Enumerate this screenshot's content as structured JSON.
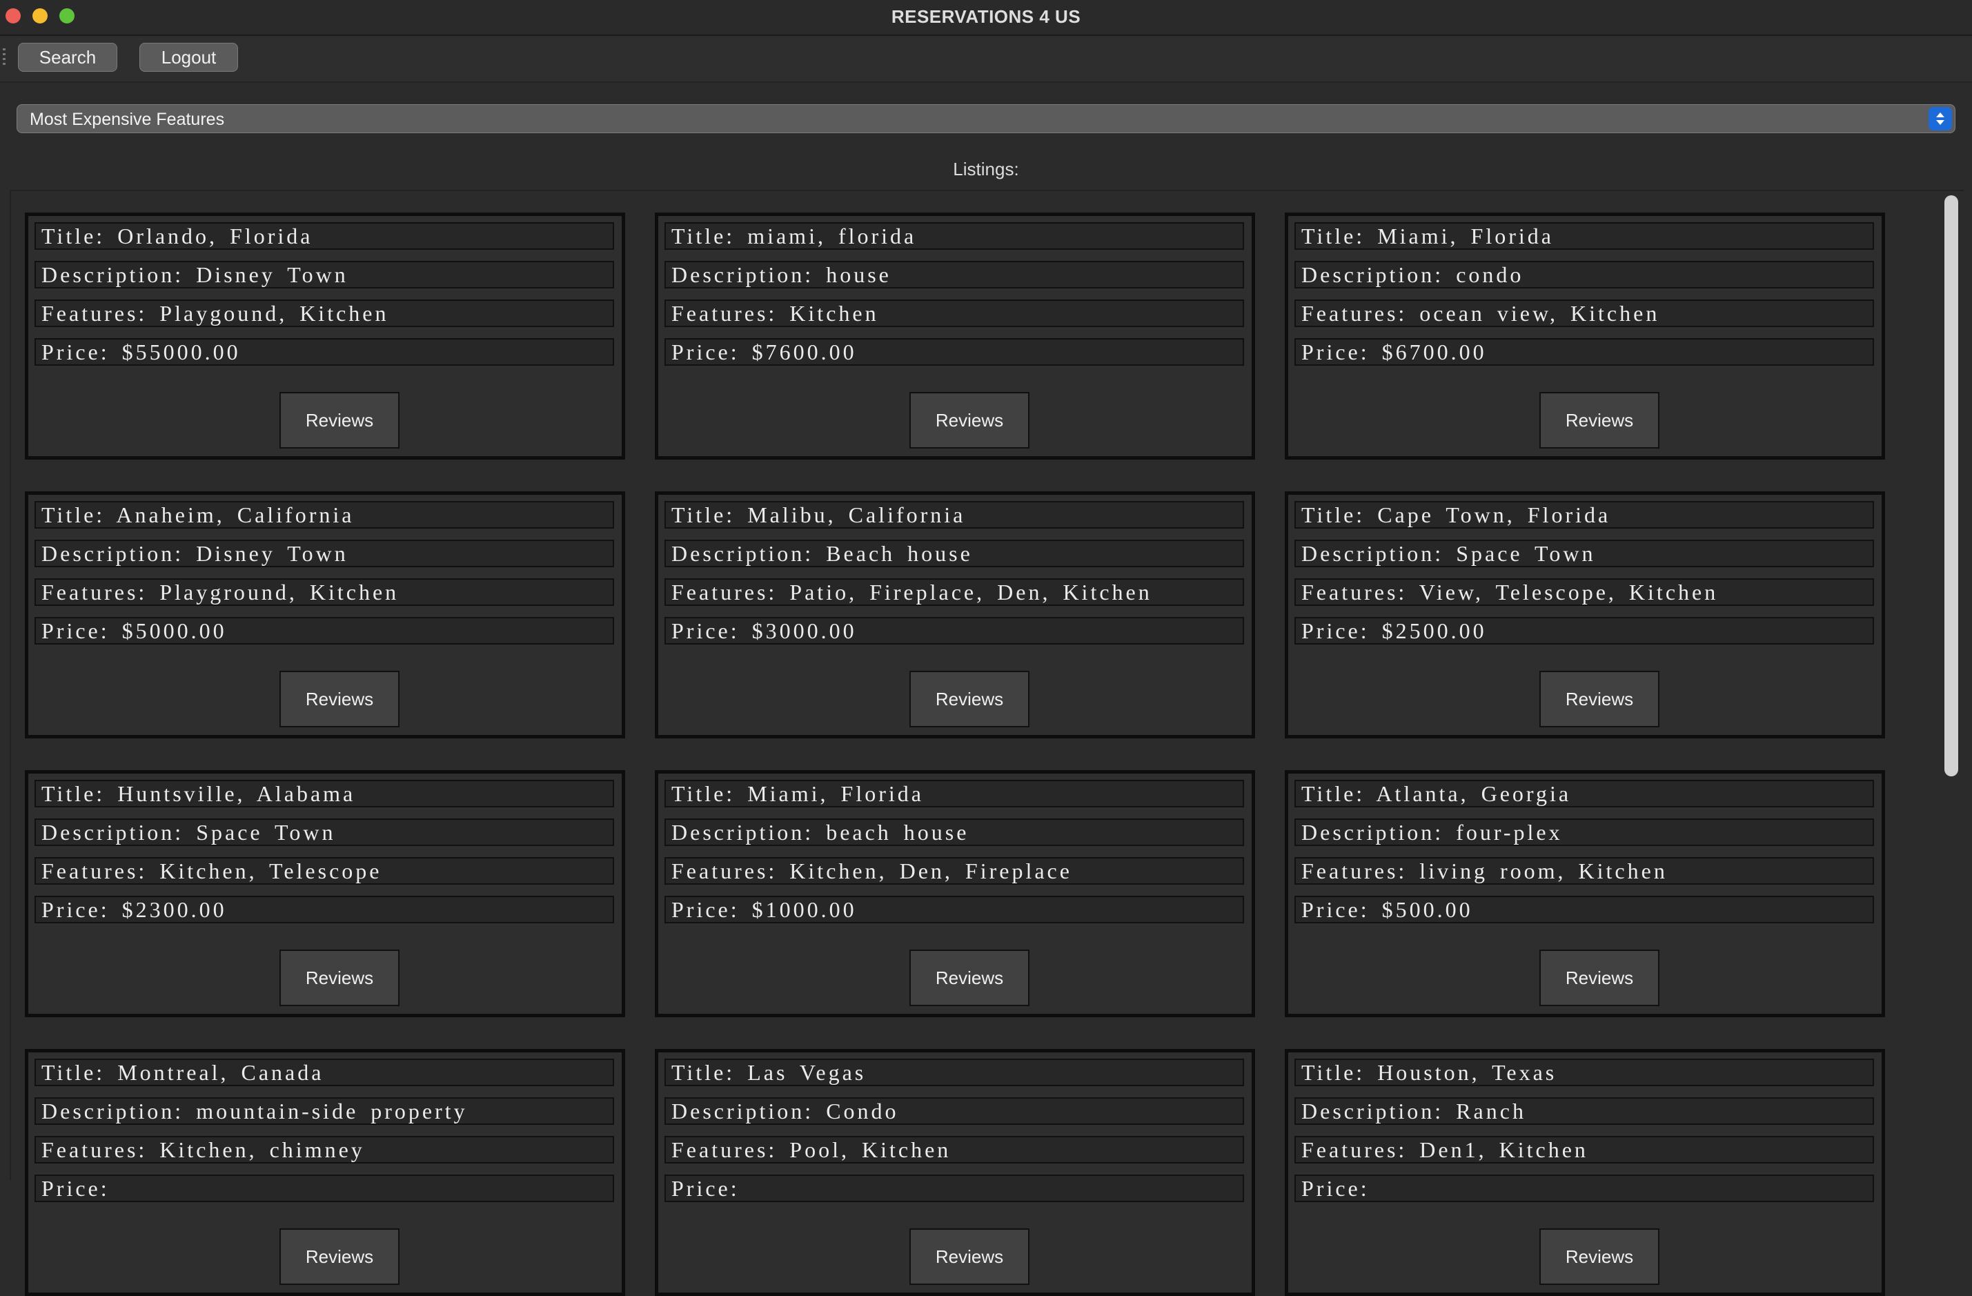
{
  "window": {
    "title": "RESERVATIONS 4 US"
  },
  "toolbar": {
    "search_label": "Search",
    "logout_label": "Logout"
  },
  "sort_select": {
    "selected": "Most Expensive Features"
  },
  "listings_label": "Listings:",
  "field_prefixes": {
    "title": "Title: ",
    "description": "Description: ",
    "features": "Features: ",
    "price": "Price: "
  },
  "review_label": "Reviews",
  "listings": [
    {
      "title": "Orlando, Florida",
      "description": "Disney Town",
      "features": "Playgound, Kitchen",
      "price": "$55000.00"
    },
    {
      "title": "miami, florida",
      "description": "house",
      "features": "Kitchen",
      "price": "$7600.00"
    },
    {
      "title": "Miami, Florida",
      "description": "condo",
      "features": "ocean view, Kitchen",
      "price": "$6700.00"
    },
    {
      "title": "Anaheim, California",
      "description": "Disney Town",
      "features": "Playground, Kitchen",
      "price": "$5000.00"
    },
    {
      "title": "Malibu, California",
      "description": "Beach house",
      "features": "Patio, Fireplace, Den, Kitchen",
      "price": "$3000.00"
    },
    {
      "title": "Cape Town, Florida",
      "description": "Space Town",
      "features": "View, Telescope, Kitchen",
      "price": "$2500.00"
    },
    {
      "title": "Huntsville, Alabama",
      "description": "Space Town",
      "features": "Kitchen, Telescope",
      "price": "$2300.00"
    },
    {
      "title": "Miami, Florida",
      "description": "beach house",
      "features": "Kitchen, Den, Fireplace",
      "price": "$1000.00"
    },
    {
      "title": "Atlanta, Georgia",
      "description": "four-plex",
      "features": "living room, Kitchen",
      "price": "$500.00"
    },
    {
      "title": "Montreal, Canada",
      "description": "mountain-side property",
      "features": "Kitchen, chimney",
      "price": ""
    },
    {
      "title": "Las Vegas",
      "description": "Condo",
      "features": "Pool, Kitchen",
      "price": ""
    },
    {
      "title": "Houston, Texas",
      "description": "Ranch",
      "features": "Den1, Kitchen",
      "price": ""
    }
  ],
  "icons": {
    "select_arrow": "up-down-chevron-icon"
  },
  "colors": {
    "accent": "#1d6bd8",
    "close": "#ee5f57",
    "minimize": "#f5bd2e",
    "zoom": "#5fc43b"
  }
}
